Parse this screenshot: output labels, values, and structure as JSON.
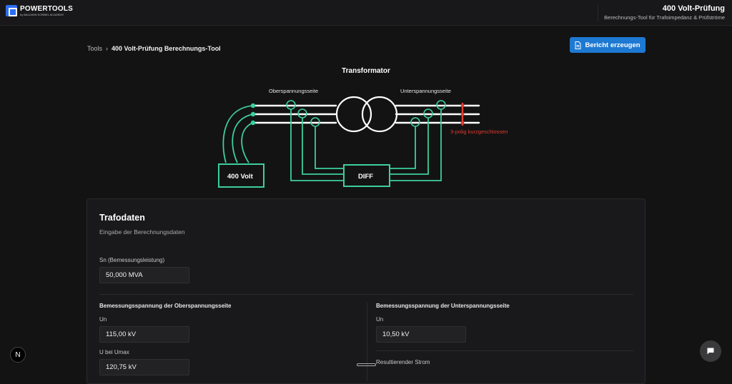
{
  "brand": {
    "name": "POWERTOOLS",
    "tagline": "by BALDWIN KORBEL ACADEMY"
  },
  "header": {
    "title": "400 Volt-Prüfung",
    "subtitle": "Berechnungs-Tool für Trafoimpedanz & Prüfströme"
  },
  "breadcrumb": {
    "root": "Tools",
    "separator": "›",
    "current": "400 Volt-Prüfung Berechnungs-Tool"
  },
  "actions": {
    "report_label": "Bericht erzeugen"
  },
  "diagram": {
    "title": "Transformator",
    "hv_label": "Oberspannungsseite",
    "lv_label": "Unterspannungsseite",
    "short_label": "3-polig kurzgeschlossen",
    "source_label": "400 Volt",
    "diff_label": "DIFF",
    "colors": {
      "wire": "#ffffff",
      "measure": "#3ecf9a",
      "short": "#e23b2e"
    }
  },
  "trafo": {
    "title": "Trafodaten",
    "subtitle": "Eingabe der Berechnungsdaten",
    "sn_label": "Sn (Bemessungsleistung)",
    "sn_value": "50,000 MVA",
    "hv": {
      "heading": "Bemessungsspannung der Oberspannungsseite",
      "un_label": "Un",
      "un_value": "115,00 kV",
      "umax_label": "U bei Umax",
      "umax_value": "120,75 kV"
    },
    "lv": {
      "heading": "Bemessungsspannung der Unterspannungsseite",
      "un_label": "Un",
      "un_value": "10,50 kV",
      "current_label": "Resultierender Strom"
    }
  },
  "misc": {
    "n_badge": "N"
  }
}
